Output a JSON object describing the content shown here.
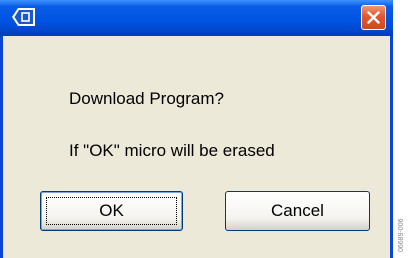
{
  "dialog": {
    "message_line1": "Download Program?",
    "message_line2": "If \"OK\" micro will be erased",
    "ok_label": "OK",
    "cancel_label": "Cancel",
    "close_icon": "close-x-icon",
    "app_icon": "app-icon"
  },
  "figure_id": "06689-006",
  "colors": {
    "titlebar": "#0054e3",
    "close_button": "#e2572b",
    "dialog_body": "#ece9d8",
    "button_border": "#003c74"
  }
}
